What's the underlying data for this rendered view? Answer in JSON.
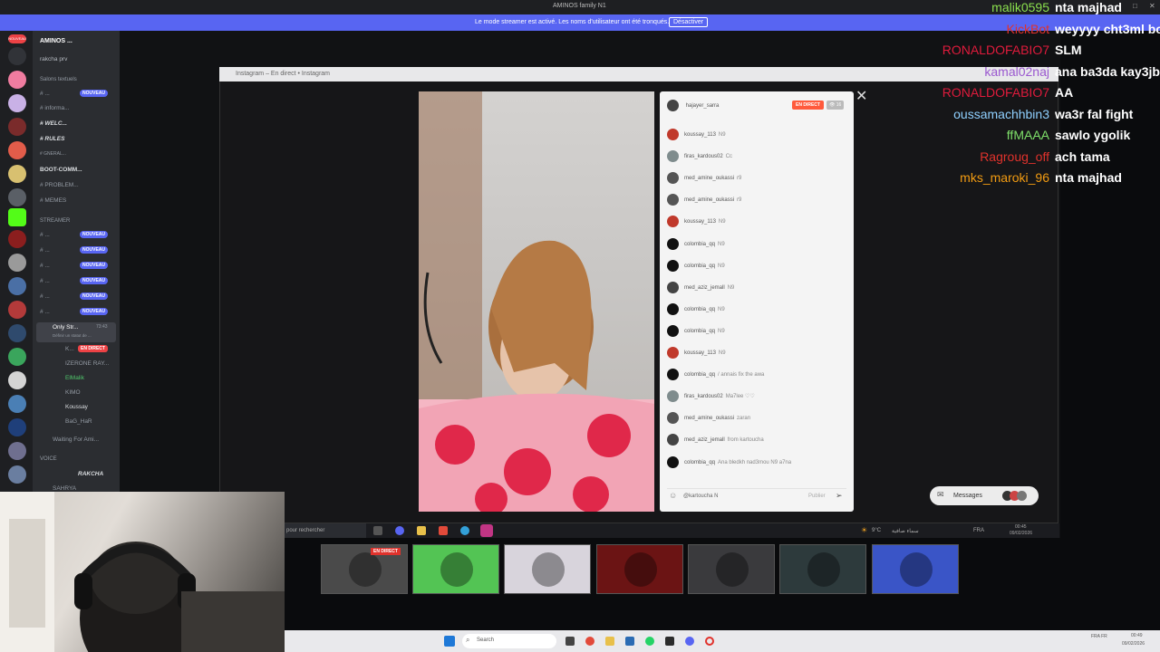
{
  "window": {
    "title": "AMINOS family N1",
    "controls": [
      "—",
      "□",
      "✕"
    ]
  },
  "banner": {
    "text": "Le mode streamer est activé. Les noms d'utilisateur ont été tronqués.",
    "button": "Désactiver"
  },
  "discord": {
    "new_badge": "NOUVEAU",
    "server_name": "AMINOS ...",
    "dm_user": "rakcha prv",
    "category_text": "Salons textuels",
    "category_streamer": "STREAMER",
    "category_voice": "VOICE",
    "text_channels": [
      "# ...",
      "# informa...",
      "# WELC...",
      "# RULES",
      "# GNERAL...",
      "BOOT-COMM...",
      "# PROBLEM...",
      "# MEMES"
    ],
    "streamer_channels": [
      "# ...",
      "# ...",
      "# ...",
      "# ...",
      "# ...",
      "# ..."
    ],
    "voice_channel": "Only Str...",
    "voice_time": "73:43",
    "voice_sub": "Définir un statut de ...",
    "voice_users": [
      "K...",
      "IZERONE RAY...",
      "ElMalik",
      "KIMO",
      "Koussay",
      "BaG_HaR"
    ],
    "live_badge": "EN DIRECT",
    "waiting": "Waiting For Ami...",
    "voice_items": [
      "RAKCHA",
      "SAHRYA"
    ]
  },
  "instagram": {
    "tab_title": "Instagram – En direct • Instagram",
    "host": "hajayer_sarra",
    "live": "EN DIRECT",
    "viewers": "👁 16",
    "comments": [
      {
        "user": "koussay_113",
        "text": "N9",
        "color": "#c0392b"
      },
      {
        "user": "firas_kardous02",
        "text": "Cc",
        "color": "#7f8c8d"
      },
      {
        "user": "med_amine_oukassi",
        "text": "r9",
        "color": "#555"
      },
      {
        "user": "med_amine_oukassi",
        "text": "r9",
        "color": "#555"
      },
      {
        "user": "koussay_113",
        "text": "N9",
        "color": "#c0392b"
      },
      {
        "user": "colombia_qq",
        "text": "N9",
        "color": "#111"
      },
      {
        "user": "colombia_qq",
        "text": "N9",
        "color": "#111"
      },
      {
        "user": "med_aziz_jemall",
        "text": "N9",
        "color": "#444"
      },
      {
        "user": "colombia_qq",
        "text": "N9",
        "color": "#111"
      },
      {
        "user": "colombia_qq",
        "text": "N9",
        "color": "#111"
      },
      {
        "user": "koussay_113",
        "text": "N9",
        "color": "#c0392b"
      },
      {
        "user": "colombia_qq",
        "text": "/ annais fix the awa",
        "color": "#111"
      },
      {
        "user": "firas_kardous02",
        "text": "Ma7lee ♡♡",
        "color": "#7f8c8d"
      },
      {
        "user": "med_amine_oukassi",
        "text": "zaran",
        "color": "#555"
      },
      {
        "user": "med_aziz_jemall",
        "text": "from kartoucha",
        "color": "#444"
      },
      {
        "user": "colombia_qq",
        "text": "Ana bledkh nad3mou N9 a7na",
        "color": "#111"
      }
    ],
    "input_value": "@kartoucha N",
    "publish": "Publier",
    "messages": "Messages"
  },
  "inner_taskbar": {
    "search": "pour rechercher",
    "weather": "9°C",
    "weather_text": "سماء صافية",
    "lang": "FRA",
    "time": "00:45",
    "date": "09/02/2026"
  },
  "thumbnails": [
    {
      "label": "instagram-live",
      "bg": "#4a4a4a"
    },
    {
      "label": "kick",
      "bg": "#53c454"
    },
    {
      "label": "anime",
      "bg": "#d8d4dc"
    },
    {
      "label": "red-fighter",
      "bg": "#6b1414"
    },
    {
      "label": "swords",
      "bg": "#3a3a3d"
    },
    {
      "label": "sticker",
      "bg": "#2d3a3c"
    },
    {
      "label": "blue-warrior",
      "bg": "#3a55c7"
    }
  ],
  "win_taskbar": {
    "search": "Search",
    "lang": "FRA FR",
    "time": "00:49",
    "date": "09/02/2026"
  },
  "chat": [
    {
      "name": "malik0595",
      "msg": "nta majhad",
      "color": "#8be04e"
    },
    {
      "name": "KickBot",
      "msg": "weyyyy cht3ml bo",
      "color": "#e0322c"
    },
    {
      "name": "RONALDOFABIO7",
      "msg": "SLM",
      "color": "#e01b3c"
    },
    {
      "name": "kamal02naj",
      "msg": "ana ba3da kay3jb",
      "color": "#9b59d0"
    },
    {
      "name": "RONALDOFABIO7",
      "msg": "AA",
      "color": "#e01b3c"
    },
    {
      "name": "oussamachhbin3",
      "msg": "wa3r fal fight",
      "color": "#8fd0ff"
    },
    {
      "name": "ffMAAA",
      "msg": "sawlo ygolik",
      "color": "#7fe06a"
    },
    {
      "name": "Ragroug_off",
      "msg": "ach tama",
      "color": "#e0322c"
    },
    {
      "name": "mks_maroki_96",
      "msg": "nta majhad",
      "color": "#f39c12"
    }
  ]
}
